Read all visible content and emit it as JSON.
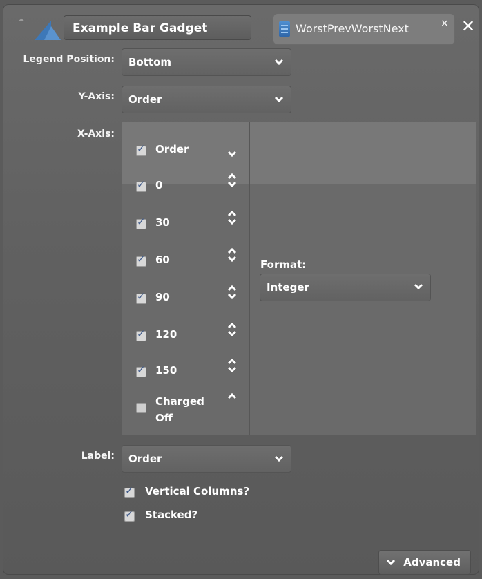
{
  "header": {
    "title": "Example Bar Gadget",
    "tab_label": "WorstPrevWorstNext",
    "tab_close": "×",
    "window_close": "✕"
  },
  "form": {
    "legend_position_label": "Legend Position:",
    "legend_position_value": "Bottom",
    "y_axis_label": "Y-Axis:",
    "y_axis_value": "Order",
    "x_axis_label": "X-Axis:",
    "x_axis_items": [
      {
        "label": "Order",
        "checked": true
      },
      {
        "label": "0",
        "checked": true
      },
      {
        "label": "30",
        "checked": true
      },
      {
        "label": "60",
        "checked": true
      },
      {
        "label": "90",
        "checked": true
      },
      {
        "label": "120",
        "checked": true
      },
      {
        "label": "150",
        "checked": true
      },
      {
        "label": "Charged Off",
        "checked": false
      }
    ],
    "format_label": "Format:",
    "format_value": "Integer",
    "label_label": "Label:",
    "label_value": "Order",
    "vertical_columns_label": "Vertical Columns?",
    "vertical_columns_checked": true,
    "stacked_label": "Stacked?",
    "stacked_checked": true
  },
  "footer": {
    "advanced_label": "Advanced"
  },
  "colors": {
    "background": "#5b5b5b",
    "panel": "#636363",
    "tab": "#7d7d7d",
    "tab_icon": "#3f78c0",
    "checkbox_mark": "#3f5a8a"
  },
  "icons": {
    "app_logo": "blue-triangle-logo-icon",
    "tab_icon": "document-icon",
    "collapse_icon": "chevron-down-icon",
    "expand_icon": "chevron-up-icon"
  }
}
